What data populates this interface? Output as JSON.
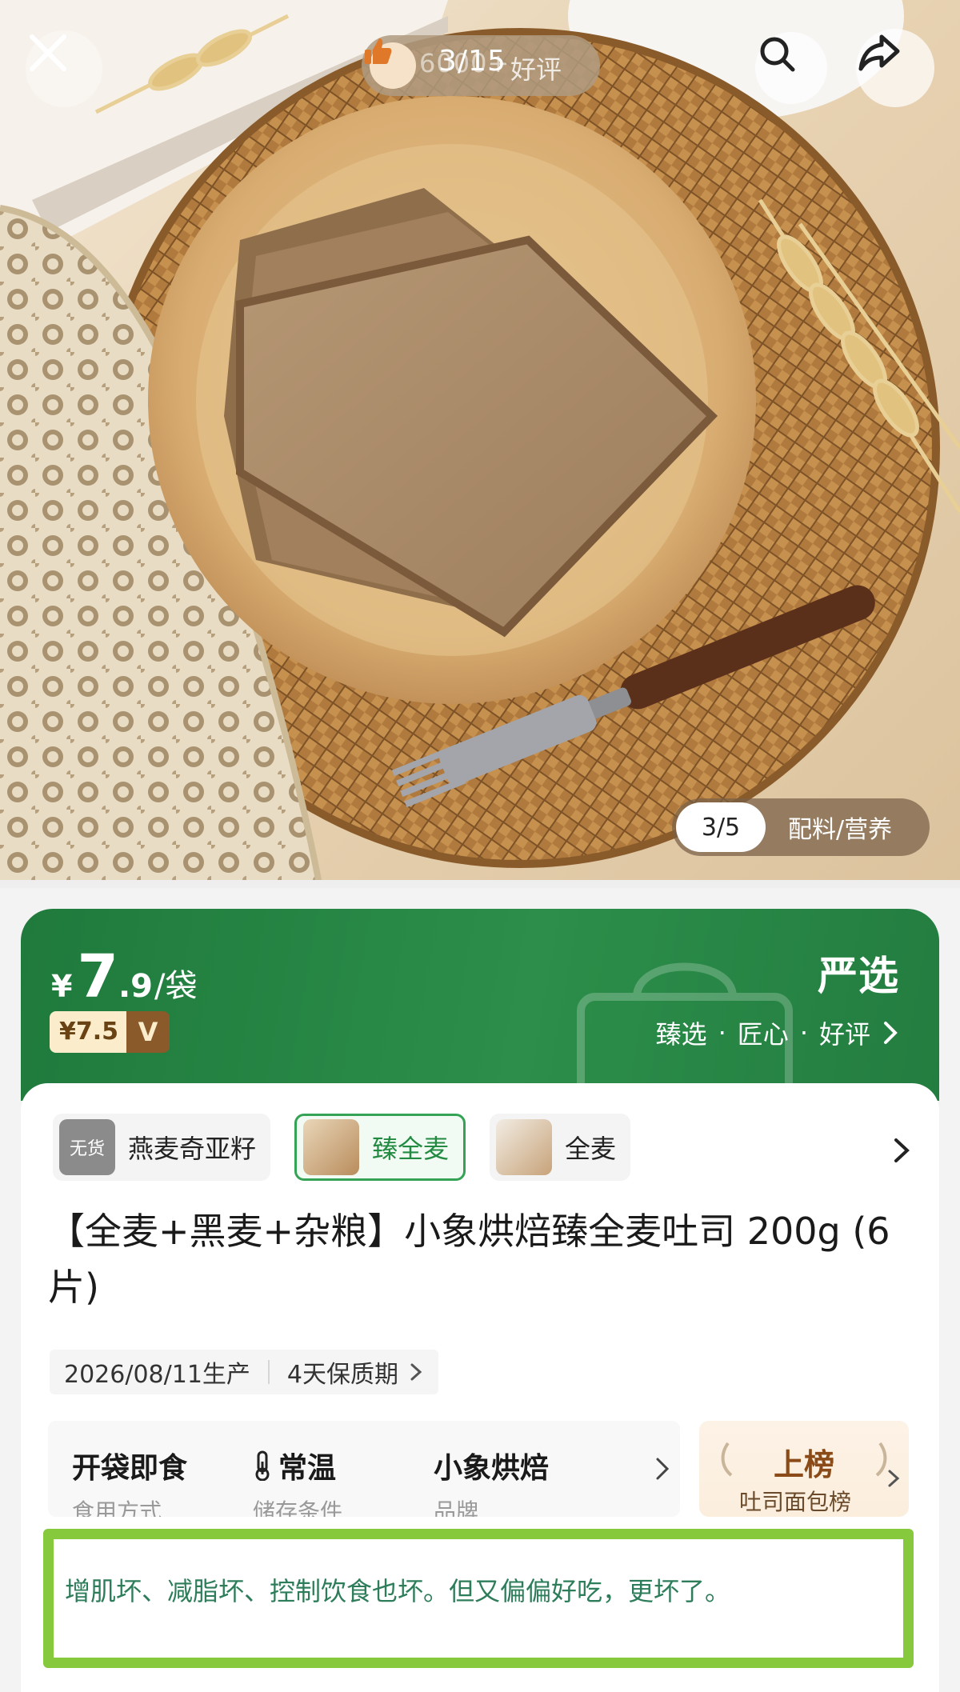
{
  "hero": {
    "review_badge": {
      "count": "6000+",
      "label": "好评"
    },
    "gallery_counter": "3/15",
    "sub_pager": {
      "index": "3/5",
      "label": "配料/营养"
    }
  },
  "price_band": {
    "currency": "¥",
    "price_int": "7",
    "price_dec": ".9",
    "unit": "/袋",
    "vip_price": "¥7.5",
    "vip_mark": "V",
    "brand": "严选",
    "slogan": [
      "臻选",
      "·",
      "匠心",
      "·",
      "好评"
    ]
  },
  "variants": [
    {
      "label": "燕麦奇亚籽",
      "stock_badge": "无货",
      "selected": false
    },
    {
      "label": "臻全麦",
      "selected": true
    },
    {
      "label": "全麦",
      "selected": false
    }
  ],
  "product": {
    "title": "【全麦+黑麦+杂粮】小象烘焙臻全麦吐司 200g (6片)",
    "production_date": "2026/08/11生产",
    "shelf_life": "4天保质期"
  },
  "attributes": [
    {
      "value": "开袋即食",
      "label": "食用方式"
    },
    {
      "value": "常温",
      "label": "储存条件"
    },
    {
      "value": "小象烘焙",
      "label": "品牌"
    }
  ],
  "rank": {
    "title": "上榜",
    "subtitle": "吐司面包榜"
  },
  "comment": "增肌坏、减脂坏、控制饮食也坏。但又偏偏好吃，更坏了。",
  "colors": {
    "brand_green": "#2c8e4a",
    "highlight_border": "#86c93c",
    "comment_text": "#2e7d5a"
  }
}
